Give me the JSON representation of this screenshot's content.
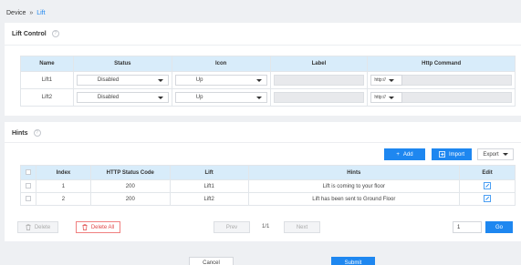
{
  "breadcrumb": {
    "parent": "Device",
    "separator": "»",
    "current": "Lift"
  },
  "lift_control": {
    "title": "Lift Control",
    "headers": [
      "Name",
      "Status",
      "Icon",
      "Label",
      "Http Command"
    ],
    "rows": [
      {
        "name": "Lift1",
        "status": "Disabled",
        "icon": "Up",
        "label": "",
        "http_prefix": "http://"
      },
      {
        "name": "Lift2",
        "status": "Disabled",
        "icon": "Up",
        "label": "",
        "http_prefix": "http://"
      }
    ]
  },
  "hints": {
    "title": "Hints",
    "toolbar": {
      "add": "Add",
      "import": "Import",
      "export": "Export"
    },
    "headers": [
      "Index",
      "HTTP Status Code",
      "Lift",
      "Hints",
      "Edit"
    ],
    "rows": [
      {
        "index": "1",
        "code": "200",
        "lift": "Lift1",
        "hint": "Lift is coming to your floor"
      },
      {
        "index": "2",
        "code": "200",
        "lift": "Lift2",
        "hint": "Lift has been sent to Ground Floor"
      }
    ],
    "delete": "Delete",
    "delete_all": "Delete All",
    "prev": "Prev",
    "page_info": "1/1",
    "next": "Next",
    "page_input": "1",
    "go": "Go"
  },
  "footer": {
    "cancel": "Cancel",
    "submit": "Submit"
  },
  "colors": {
    "accent": "#1e87f0",
    "header_bg": "#d8ecfa",
    "danger": "#e04848"
  }
}
